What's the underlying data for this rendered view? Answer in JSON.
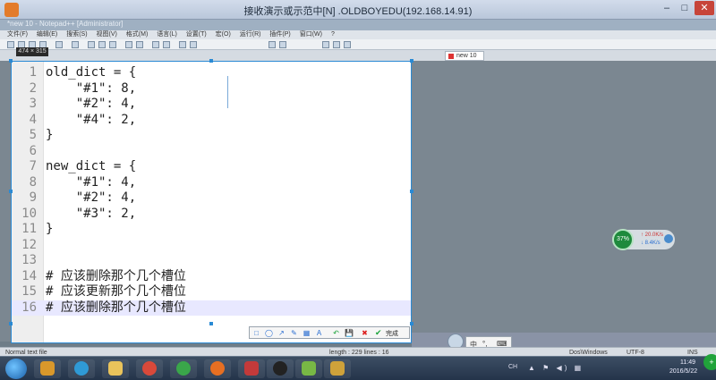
{
  "window": {
    "title": "接收演示或示范中[N] .OLDBOYEDU(192.168.14.91)",
    "min": "–",
    "max": "□",
    "close": "✕"
  },
  "notepad": {
    "title": "*new 10 - Notepad++ [Administrator]",
    "menu": [
      "文件(F)",
      "编辑(E)",
      "搜索(S)",
      "视图(V)",
      "格式(M)",
      "语言(L)",
      "设置(T)",
      "宏(O)",
      "运行(R)",
      "插件(P)",
      "窗口(W)",
      "?"
    ],
    "tab": "new 10",
    "status": {
      "filetype": "Normal text file",
      "length": "length : 229    lines : 16",
      "eol": "Dos\\Windows",
      "encoding": "UTF-8",
      "mode": "INS"
    }
  },
  "capture": {
    "size_label": "474 × 315",
    "code_lines": [
      {
        "n": "1",
        "text": "old_dict = {"
      },
      {
        "n": "2",
        "text": "    \"#1\": 8,"
      },
      {
        "n": "3",
        "text": "    \"#2\": 4,"
      },
      {
        "n": "4",
        "text": "    \"#4\": 2,"
      },
      {
        "n": "5",
        "text": "}"
      },
      {
        "n": "6",
        "text": ""
      },
      {
        "n": "7",
        "text": "new_dict = {"
      },
      {
        "n": "8",
        "text": "    \"#1\": 4,"
      },
      {
        "n": "9",
        "text": "    \"#2\": 4,"
      },
      {
        "n": "10",
        "text": "    \"#3\": 2,"
      },
      {
        "n": "11",
        "text": "}"
      },
      {
        "n": "12",
        "text": ""
      },
      {
        "n": "13",
        "text": ""
      },
      {
        "n": "14",
        "text": "# 应该删除那个几个槽位"
      },
      {
        "n": "15",
        "text": "# 应该更新那个几个槽位"
      },
      {
        "n": "16",
        "text": "# 应该删除那个几个槽位"
      }
    ],
    "toolbar": {
      "rect": "□",
      "ellipse": "◯",
      "arrow": "↗",
      "pen": "✎",
      "mosaic": "▦",
      "text": "A",
      "undo": "↶",
      "save": "💾",
      "cancel": "✖",
      "confirm": "✔",
      "done": "完成"
    }
  },
  "widget": {
    "percent": "37%",
    "up": "↑ 20.0K/s",
    "down": "↓ 8.4K/s"
  },
  "ime": {
    "mode": "中",
    "punct": "°,",
    "soft": "⌨"
  },
  "taskbar": {
    "lang": "CH",
    "tray": "▲ ⚑ ◀) ▦",
    "time": "11:49",
    "date": "2016/5/22",
    "badge": "+"
  },
  "colors": {
    "selection_border": "#2a8ad4",
    "current_line": "#e8e8ff",
    "close_button": "#c7453a"
  }
}
